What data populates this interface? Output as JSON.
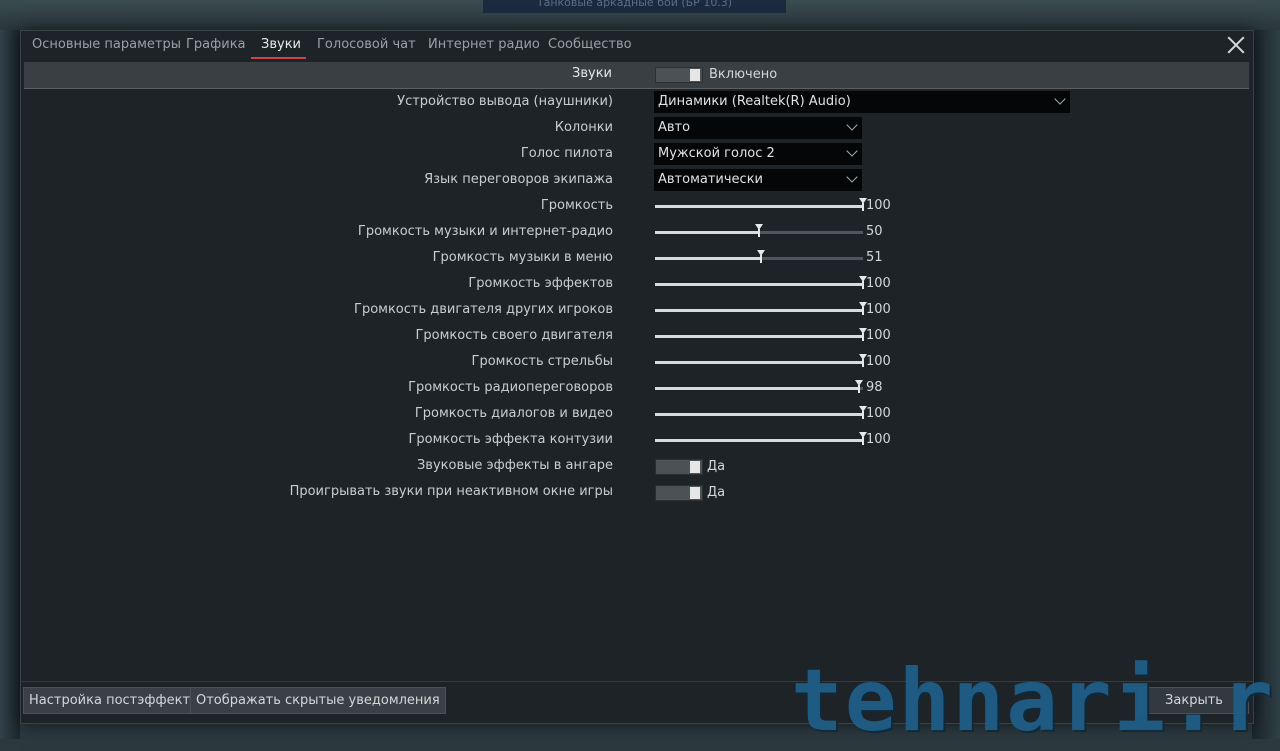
{
  "banner": "Танковые аркадные бои (БР 10.3)",
  "tabs": [
    {
      "label": "Основные параметры"
    },
    {
      "label": "Графика"
    },
    {
      "label": "Звуки"
    },
    {
      "label": "Голосовой чат"
    },
    {
      "label": "Интернет радио"
    },
    {
      "label": "Сообщество"
    }
  ],
  "active_tab": "Звуки",
  "sound_header": {
    "label": "Звуки",
    "toggle_text": "Включено"
  },
  "selects": {
    "output_device": {
      "label": "Устройство вывода (наушники)",
      "value": "Динамики (Realtek(R) Audio)"
    },
    "speakers": {
      "label": "Колонки",
      "value": "Авто"
    },
    "pilot_voice": {
      "label": "Голос пилота",
      "value": "Мужской голос 2"
    },
    "crew_language": {
      "label": "Язык переговоров экипажа",
      "value": "Автоматически"
    }
  },
  "sliders": [
    {
      "label": "Громкость",
      "value": 100
    },
    {
      "label": "Громкость музыки и интернет-радио",
      "value": 50
    },
    {
      "label": "Громкость музыки в меню",
      "value": 51
    },
    {
      "label": "Громкость эффектов",
      "value": 100
    },
    {
      "label": "Громкость двигателя других игроков",
      "value": 100
    },
    {
      "label": "Громкость своего двигателя",
      "value": 100
    },
    {
      "label": "Громкость стрельбы",
      "value": 100
    },
    {
      "label": "Громкость радиопереговоров",
      "value": 98
    },
    {
      "label": "Громкость диалогов и видео",
      "value": 100
    },
    {
      "label": "Громкость эффекта контузии",
      "value": 100
    }
  ],
  "toggles": [
    {
      "label": "Звуковые эффекты в ангаре",
      "text": "Да"
    },
    {
      "label": "Проигрывать звуки при неактивном окне игры",
      "text": "Да"
    }
  ],
  "footer": {
    "postfx_button": "Настройка постэффектов",
    "hidden_notifications_button": "Отображать скрытые уведомления",
    "close_button": "Закрыть"
  },
  "watermark": "tehnari.ru",
  "colors": {
    "accent": "#c7464b",
    "panel": "#1e2327",
    "watermark": "#1f5d86"
  }
}
